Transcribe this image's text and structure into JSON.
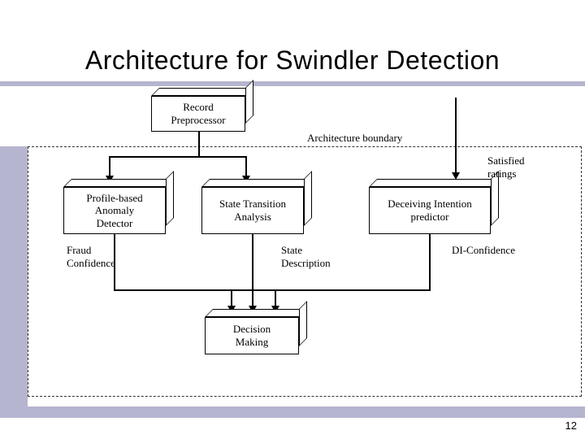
{
  "title": "Architecture for Swindler Detection",
  "page_number": "12",
  "diagram": {
    "boundary_label": "Architecture boundary",
    "nodes": {
      "record_preprocessor": "Record\nPreprocessor",
      "profile_detector": "Profile-based\nAnomaly\nDetector",
      "state_transition": "State Transition\nAnalysis",
      "deceiving_predictor": "Deceiving Intention\npredictor",
      "decision_making": "Decision\nMaking"
    },
    "edge_labels": {
      "satisfied_ratings": "Satisfied\nratings",
      "fraud_confidence": "Fraud\nConfidence",
      "state_description": "State\nDescription",
      "di_confidence": "DI-Confidence"
    }
  }
}
